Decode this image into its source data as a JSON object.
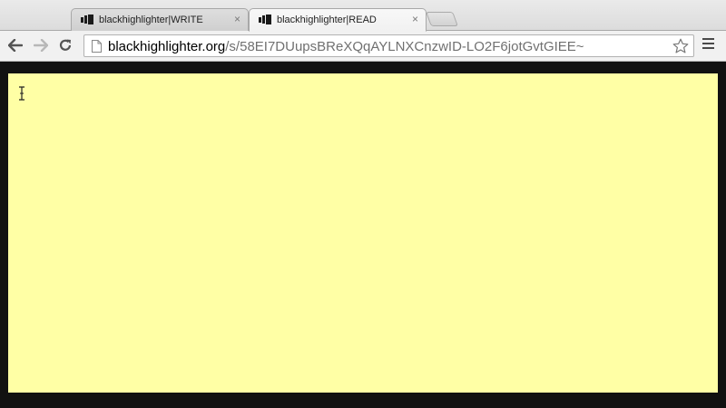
{
  "browser": {
    "tabs": [
      {
        "title": "blackhighlighter|WRITE",
        "close_label": "×",
        "active": false
      },
      {
        "title": "blackhighlighter|READ",
        "close_label": "×",
        "active": true
      }
    ],
    "address_bar": {
      "host": "blackhighlighter.org",
      "path": "/s/58EI7DUupsBReXQqAYLNXCnzwID-LO2F6jotGvtGIEE~"
    },
    "icons": {
      "back": "arrow-left-icon",
      "forward": "arrow-right-icon",
      "reload": "reload-icon",
      "page": "page-icon",
      "bookmark": "star-icon",
      "menu": "hamburger-menu-icon",
      "favicon": "blackhighlighter-logo-icon"
    }
  },
  "page": {
    "note_background": "#ffffa5",
    "frame_background": "#111111"
  }
}
